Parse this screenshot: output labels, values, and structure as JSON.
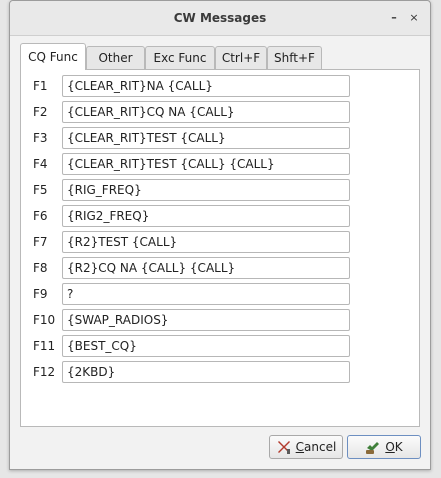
{
  "window": {
    "title": "CW Messages",
    "minimize_label": "–",
    "close_label": "×"
  },
  "tabs": [
    {
      "label": "CQ Func",
      "active": true
    },
    {
      "label": "Other",
      "active": false
    },
    {
      "label": "Exc Func",
      "active": false
    },
    {
      "label": "Ctrl+F",
      "active": false
    },
    {
      "label": "Shft+F",
      "active": false
    }
  ],
  "messages": [
    {
      "key": "F1",
      "value": "{CLEAR_RIT}NA {CALL}"
    },
    {
      "key": "F2",
      "value": "{CLEAR_RIT}CQ NA {CALL}"
    },
    {
      "key": "F3",
      "value": "{CLEAR_RIT}TEST {CALL}"
    },
    {
      "key": "F4",
      "value": "{CLEAR_RIT}TEST {CALL} {CALL}"
    },
    {
      "key": "F5",
      "value": "{RIG_FREQ}"
    },
    {
      "key": "F6",
      "value": "{RIG2_FREQ}"
    },
    {
      "key": "F7",
      "value": "{R2}TEST {CALL}"
    },
    {
      "key": "F8",
      "value": "{R2}CQ NA {CALL} {CALL}"
    },
    {
      "key": "F9",
      "value": "?"
    },
    {
      "key": "F10",
      "value": "{SWAP_RADIOS}"
    },
    {
      "key": "F11",
      "value": "{BEST_CQ}"
    },
    {
      "key": "F12",
      "value": "{2KBD}"
    }
  ],
  "buttons": {
    "cancel": {
      "mnemonic": "C",
      "rest": "ancel",
      "icon": "x-icon"
    },
    "ok": {
      "mnemonic": "O",
      "rest": "K",
      "icon": "ok-hand-icon"
    }
  },
  "colors": {
    "cancel_icon": "#b33a2c",
    "ok_icon": "#3f7f3a"
  }
}
